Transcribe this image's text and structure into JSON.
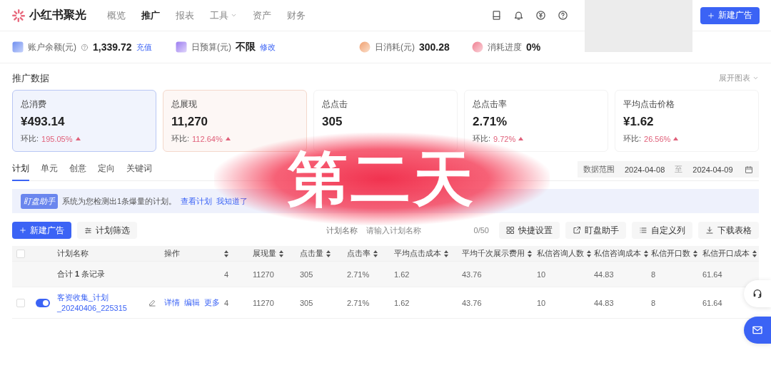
{
  "brand": {
    "name": "小红书聚光"
  },
  "nav": [
    {
      "label": "概览",
      "selected": false,
      "dropdown": false
    },
    {
      "label": "推广",
      "selected": true,
      "dropdown": false
    },
    {
      "label": "报表",
      "selected": false,
      "dropdown": false
    },
    {
      "label": "工具",
      "selected": false,
      "dropdown": true
    },
    {
      "label": "资产",
      "selected": false,
      "dropdown": false
    },
    {
      "label": "财务",
      "selected": false,
      "dropdown": false
    }
  ],
  "header_button": "新建广告",
  "account_stats": [
    {
      "kind": "balance",
      "label": "账户余额(元)",
      "value": "1,339.72",
      "link": "充值"
    },
    {
      "kind": "budget",
      "label": "日预算(元)",
      "value": "不限",
      "link": "修改"
    },
    {
      "kind": "spend",
      "label": "日消耗(元)",
      "value": "300.28"
    },
    {
      "kind": "progress",
      "label": "消耗进度",
      "value": "0%"
    }
  ],
  "metrics": {
    "title": "推广数据",
    "expand_link": "展开图表",
    "cards": [
      {
        "label": "总消费",
        "value": "¥493.14",
        "change_label": "环比:",
        "change": "195.05%",
        "selected": true,
        "color": "#b9c7f4"
      },
      {
        "label": "总展现",
        "value": "11,270",
        "change_label": "环比:",
        "change": "112.64%",
        "selected": true,
        "color": "#f4d8cb"
      },
      {
        "label": "总点击",
        "value": "305",
        "selected": false
      },
      {
        "label": "总点击率",
        "value": "2.71%",
        "change_label": "环比:",
        "change": "9.72%",
        "selected": false
      },
      {
        "label": "平均点击价格",
        "value": "¥1.62",
        "change_label": "环比:",
        "change": "26.56%",
        "selected": false
      }
    ]
  },
  "tabs": [
    {
      "label": "计划",
      "selected": true
    },
    {
      "label": "单元",
      "selected": false
    },
    {
      "label": "创意",
      "selected": false
    },
    {
      "label": "定向",
      "selected": false
    },
    {
      "label": "关键词",
      "selected": false
    }
  ],
  "date_range": {
    "label": "数据范围",
    "start": "2024-04-08",
    "separator": "至",
    "end": "2024-04-09"
  },
  "alert": {
    "badge": "盯盘助手",
    "message": "系统为您检测出1条爆量的计划。",
    "links": [
      "查看计划",
      "我知道了"
    ]
  },
  "toolbar": {
    "new_button": "新建广告",
    "filter_button": "计划筛选",
    "search": {
      "label": "计划名称",
      "placeholder": "请输入计划名称",
      "counter": "0/50"
    },
    "actions": [
      {
        "kind": "grid",
        "label": "快捷设置"
      },
      {
        "kind": "external",
        "label": "盯盘助手"
      },
      {
        "kind": "list",
        "label": "自定义列"
      },
      {
        "kind": "download",
        "label": "下载表格"
      }
    ]
  },
  "table": {
    "select_all_checked": false,
    "columns": [
      {
        "label": "计划名称",
        "sortable": false
      },
      {
        "label": "操作",
        "sortable": false
      },
      {
        "sortable": true
      },
      {
        "label": "展现量",
        "sortable": true
      },
      {
        "label": "点击量",
        "sortable": true
      },
      {
        "label": "点击率",
        "sortable": true
      },
      {
        "label": "平均点击成本",
        "sortable": true
      },
      {
        "label": "平均千次展示费用",
        "sortable": true
      },
      {
        "label": "私信咨询人数",
        "sortable": true
      },
      {
        "label": "私信咨询成本",
        "sortable": true
      },
      {
        "label": "私信开口数",
        "sortable": true
      },
      {
        "label": "私信开口成本",
        "sortable": true
      }
    ],
    "total_row": {
      "cells": [
        "合计 **1** 条记录",
        "",
        "4",
        "11270",
        "305",
        "2.71%",
        "1.62",
        "43.76",
        "10",
        "44.83",
        "8",
        "61.64"
      ]
    },
    "rows": [
      {
        "checked": false,
        "on": true,
        "cells": [
          "客资收集_计划_20240406_225315",
          [
            "详情",
            "编辑",
            "更多"
          ],
          "4",
          "11270",
          "305",
          "2.71%",
          "1.62",
          "43.76",
          "10",
          "44.83",
          "8",
          "61.64"
        ]
      }
    ]
  },
  "overlay_caption": "第二天"
}
